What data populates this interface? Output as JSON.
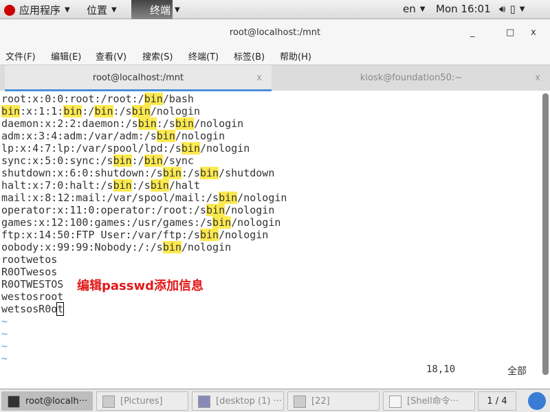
{
  "topbar": {
    "apps": "应用程序",
    "places": "位置",
    "terminal": "终端",
    "lang": "en",
    "clock": "Mon 16:01"
  },
  "window": {
    "title": "root@localhost:/mnt",
    "minimize": "_",
    "maximize": "□",
    "close": "x"
  },
  "menu": [
    "文件(F)",
    "编辑(E)",
    "查看(V)",
    "搜索(S)",
    "终端(T)",
    "标签(B)",
    "帮助(H)"
  ],
  "tabs": [
    {
      "label": "root@localhost:/mnt",
      "close": "x",
      "active": true
    },
    {
      "label": "kiosk@foundation50:~",
      "close": "x",
      "active": false
    }
  ],
  "terminal": {
    "highlight": "bin",
    "highlight_color": "#fce94f",
    "lines": [
      "root:x:0:0:root:/root:/bin/bash",
      "bin:x:1:1:bin:/bin:/sbin/nologin",
      "daemon:x:2:2:daemon:/sbin:/sbin/nologin",
      "adm:x:3:4:adm:/var/adm:/sbin/nologin",
      "lp:x:4:7:lp:/var/spool/lpd:/sbin/nologin",
      "sync:x:5:0:sync:/sbin:/bin/sync",
      "shutdown:x:6:0:shutdown:/sbin:/sbin/shutdown",
      "halt:x:7:0:halt:/sbin:/sbin/halt",
      "mail:x:8:12:mail:/var/spool/mail:/sbin/nologin",
      "operator:x:11:0:operator:/root:/sbin/nologin",
      "games:x:12:100:games:/usr/games:/sbin/nologin",
      "ftp:x:14:50:FTP User:/var/ftp:/sbin/nologin",
      "oobody:x:99:99:Nobody:/:/sbin/nologin",
      "rootwetos",
      "R0OTwesos",
      "R0OTWESTOS",
      "westosroot"
    ],
    "cursor_line_before": "wetsosR0o",
    "cursor_char": "t",
    "tildes": [
      "~",
      "~",
      "~",
      "~"
    ],
    "position": "18,10",
    "scroll_status": "全部",
    "annotation": "编辑passwd添加信息"
  },
  "taskbar": [
    {
      "label": "root@localh···",
      "active": true
    },
    {
      "label": "[Pictures]"
    },
    {
      "label": "[desktop (1) ···"
    },
    {
      "label": "[22]"
    },
    {
      "label": "[Shell命令···"
    }
  ],
  "workspace": "1 / 4"
}
